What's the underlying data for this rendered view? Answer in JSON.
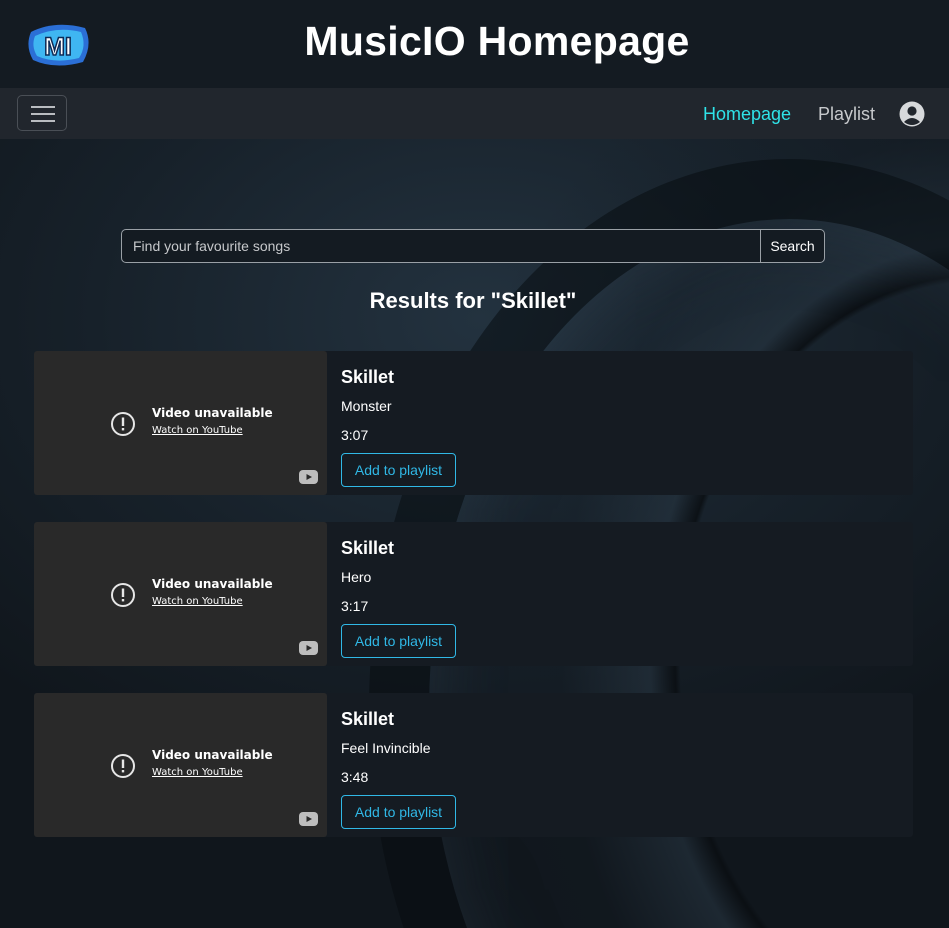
{
  "header": {
    "title": "MusicIO Homepage",
    "logo_text": "MI"
  },
  "nav": {
    "links": [
      {
        "label": "Homepage",
        "active": true
      },
      {
        "label": "Playlist",
        "active": false
      }
    ],
    "icons": [
      "menu-icon",
      "user-circle-icon"
    ]
  },
  "search": {
    "placeholder": "Find your favourite songs",
    "value": "",
    "button_label": "Search"
  },
  "results": {
    "title": "Results for \"Skillet\"",
    "items": [
      {
        "artist": "Skillet",
        "song": "Monster",
        "duration": "3:07",
        "button": "Add to playlist",
        "video_status": "Video unavailable",
        "video_link": "Watch on YouTube"
      },
      {
        "artist": "Skillet",
        "song": "Hero",
        "duration": "3:17",
        "button": "Add to playlist",
        "video_status": "Video unavailable",
        "video_link": "Watch on YouTube"
      },
      {
        "artist": "Skillet",
        "song": "Feel Invincible",
        "duration": "3:48",
        "button": "Add to playlist",
        "video_status": "Video unavailable",
        "video_link": "Watch on YouTube"
      }
    ]
  },
  "colors": {
    "active_link": "#2fe3e8",
    "accent_button": "#30b8e6",
    "navbar": "#21262d",
    "page_background": "#141b22"
  }
}
